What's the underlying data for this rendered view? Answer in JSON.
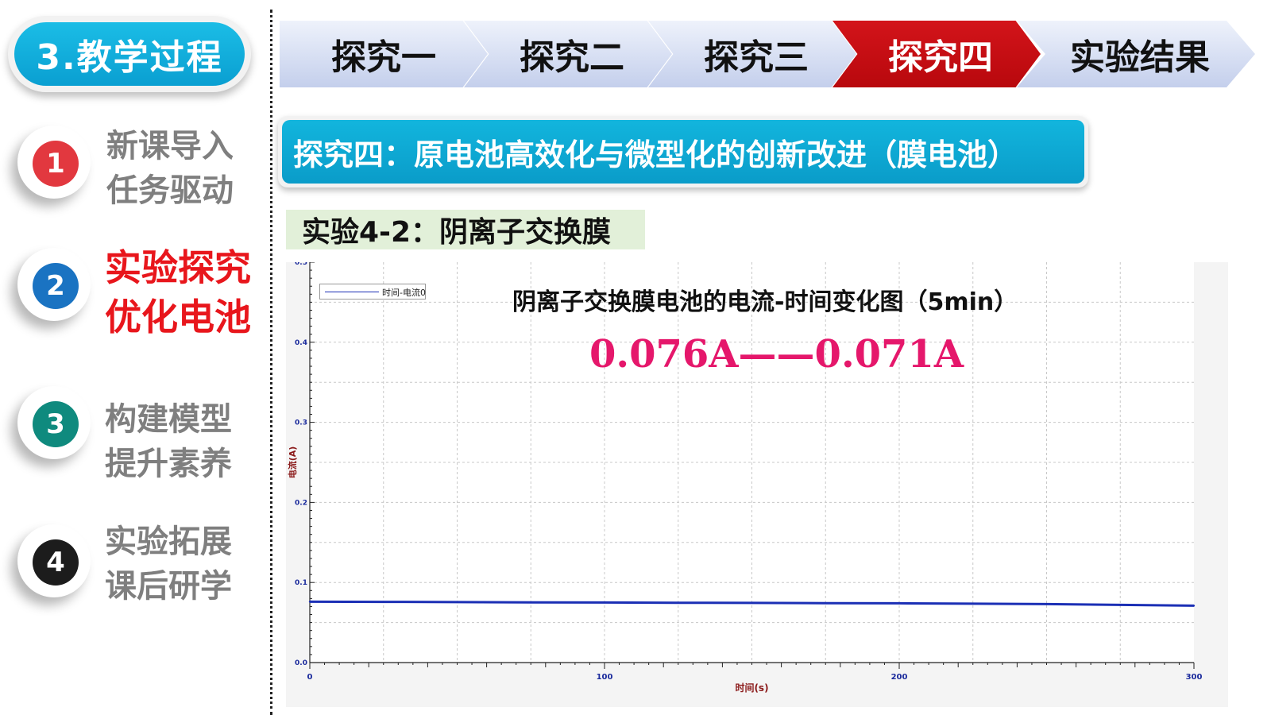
{
  "section": {
    "title": "3.教学过程"
  },
  "sidebar": {
    "items": [
      {
        "number": "1",
        "line1": "新课导入",
        "line2": "任务驱动",
        "color": "#e2383f",
        "active": false
      },
      {
        "number": "2",
        "line1": "实验探究",
        "line2": "优化电池",
        "color": "#1a73c2",
        "active": true
      },
      {
        "number": "3",
        "line1": "构建模型",
        "line2": "提升素养",
        "color": "#0f8a7e",
        "active": false
      },
      {
        "number": "4",
        "line1": "实验拓展",
        "line2": "课后研学",
        "color": "#1c1c1c",
        "active": false
      }
    ]
  },
  "steps": [
    {
      "label": "探究一",
      "active": false
    },
    {
      "label": "探究二",
      "active": false
    },
    {
      "label": "探究三",
      "active": false
    },
    {
      "label": "探究四",
      "active": true
    },
    {
      "label": "实验结果",
      "active": false
    }
  ],
  "topic": {
    "title": "探究四：原电池高效化与微型化的创新改进（膜电池）"
  },
  "experiment": {
    "label": "实验4-2：阴离子交换膜"
  },
  "colors": {
    "accent": "#0a9fd1",
    "active_step": "#c8101a",
    "annotation": "#e5176b",
    "series": "#1b2fb5"
  },
  "chart_data": {
    "type": "line",
    "title": "阴离子交换膜电池的电流-时间变化图（5min）",
    "annotation": "0.076A——0.071A",
    "xlabel": "时间(s)",
    "ylabel": "电流(A)",
    "xlim": [
      0,
      300
    ],
    "ylim": [
      0,
      0.5
    ],
    "x_ticks": [
      "0",
      "100",
      "200",
      "300"
    ],
    "y_ticks": [
      "0.0",
      "0.1",
      "0.2",
      "0.3",
      "0.4",
      "0.5"
    ],
    "grid": true,
    "legend": "top-left",
    "series": [
      {
        "name": "时间-电流0",
        "x": [
          0,
          25,
          50,
          75,
          100,
          125,
          150,
          175,
          200,
          225,
          250,
          275,
          300
        ],
        "y": [
          0.076,
          0.0758,
          0.0755,
          0.0752,
          0.075,
          0.0747,
          0.0745,
          0.0742,
          0.074,
          0.0735,
          0.073,
          0.072,
          0.071
        ]
      }
    ]
  }
}
